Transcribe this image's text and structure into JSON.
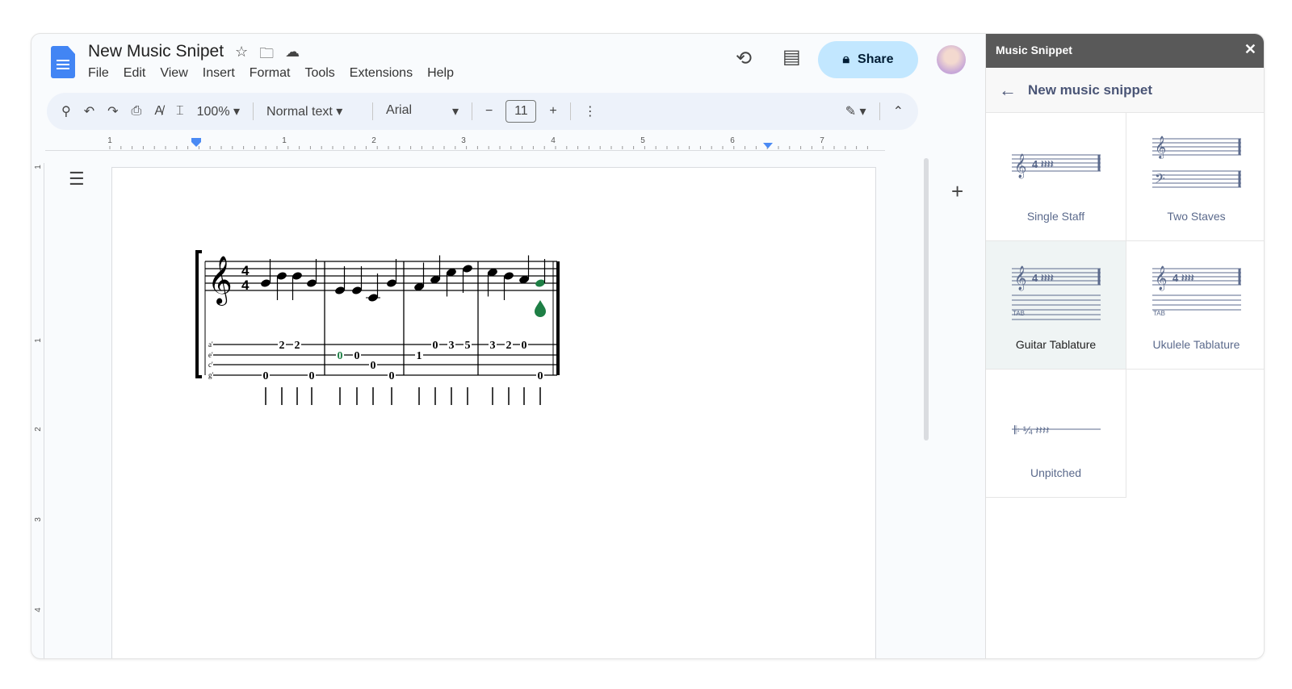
{
  "doc": {
    "title": "New Music Snipet",
    "menu": [
      "File",
      "Edit",
      "View",
      "Insert",
      "Format",
      "Tools",
      "Extensions",
      "Help"
    ],
    "share_label": "Share"
  },
  "toolbar": {
    "zoom": "100%",
    "style": "Normal text",
    "font": "Arial",
    "font_size": "11"
  },
  "ruler": {
    "labels": [
      "1",
      "1",
      "2",
      "3",
      "4",
      "5",
      "6",
      "7"
    ],
    "vlabels": [
      "1",
      "1",
      "2",
      "3",
      "4"
    ]
  },
  "panel": {
    "title": "Music Snippet",
    "subtitle": "New music snippet",
    "templates": [
      {
        "label": "Single Staff"
      },
      {
        "label": "Two Staves"
      },
      {
        "label": "Guitar Tablature",
        "selected": true
      },
      {
        "label": "Ukulele Tablature"
      },
      {
        "label": "Unpitched"
      }
    ]
  },
  "music": {
    "time_signature": [
      "4",
      "4"
    ],
    "tab_strings": [
      "a'",
      "e'",
      "c'",
      "g'"
    ],
    "highlight_color": "#1e7f45",
    "measures": [
      [
        {
          "pitch": "G4",
          "string": 3,
          "fret": "0"
        },
        {
          "pitch": "B4",
          "string": 0,
          "fret": "2"
        },
        {
          "pitch": "B4",
          "string": 0,
          "fret": "2"
        },
        {
          "pitch": "G4",
          "string": 3,
          "fret": "0"
        }
      ],
      [
        {
          "pitch": "E4",
          "string": 1,
          "fret": "0",
          "highlight": true
        },
        {
          "pitch": "E4",
          "string": 1,
          "fret": "0"
        },
        {
          "pitch": "C4",
          "string": 2,
          "fret": "0"
        },
        {
          "pitch": "G4",
          "string": 3,
          "fret": "0"
        }
      ],
      [
        {
          "pitch": "F4",
          "string": 1,
          "fret": "1"
        },
        {
          "pitch": "A4",
          "string": 0,
          "fret": "0"
        },
        {
          "pitch": "C5",
          "string": 0,
          "fret": "3"
        },
        {
          "pitch": "D5",
          "string": 0,
          "fret": "5"
        }
      ],
      [
        {
          "pitch": "C5",
          "string": 0,
          "fret": "3"
        },
        {
          "pitch": "B4",
          "string": 0,
          "fret": "2"
        },
        {
          "pitch": "A4",
          "string": 0,
          "fret": "0"
        },
        {
          "pitch": "G4",
          "string": 3,
          "fret": "0",
          "highlight": true
        }
      ]
    ]
  }
}
